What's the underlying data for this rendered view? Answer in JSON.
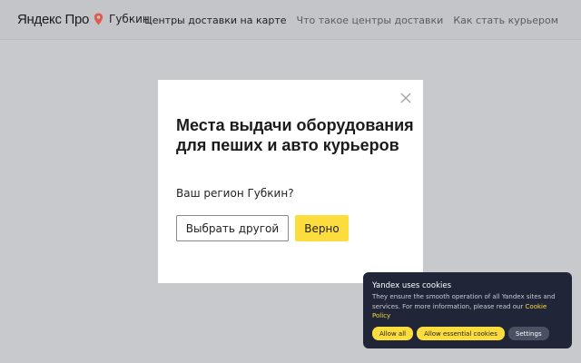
{
  "header": {
    "logo": "Яндекс Про",
    "city": "Губкин",
    "nav": [
      {
        "label": "Центры доставки на карте",
        "active": true
      },
      {
        "label": "Что такое центры доставки",
        "active": false
      },
      {
        "label": "Как стать курьером",
        "active": false
      }
    ]
  },
  "modal": {
    "title": "Места выдачи оборудования для пеших и авто курьеров",
    "question": "Ваш регион Губкин?",
    "choose_other_label": "Выбрать другой",
    "confirm_label": "Верно",
    "close_icon": "close-icon"
  },
  "cookie_banner": {
    "title": "Yandex uses cookies",
    "text": "They ensure the smooth operation of all Yandex sites and services. For more information, please read our",
    "link_text": "Cookie Policy",
    "buttons": {
      "allow_all": "Allow all",
      "allow_essential": "Allow essential cookies",
      "settings": "Settings"
    }
  },
  "colors": {
    "accent": "#fddd3e",
    "pin": "#e05a4e",
    "banner_bg": "#202638",
    "overlay_bg": "#c8c9cc"
  }
}
